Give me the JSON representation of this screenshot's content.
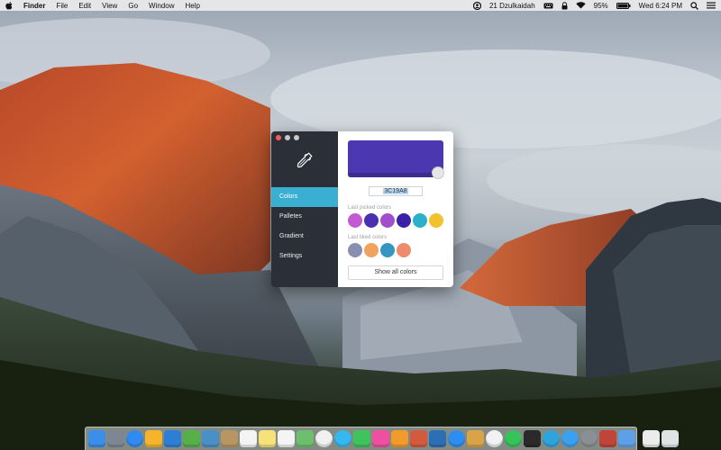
{
  "menubar": {
    "app_name": "Finder",
    "menus": [
      "File",
      "Edit",
      "View",
      "Go",
      "Window",
      "Help"
    ],
    "user": "21 Dzulkaidah",
    "battery": "95%",
    "clock": "Wed 6:24 PM"
  },
  "app": {
    "nav": [
      "Colors",
      "Palletes",
      "Gradient",
      "Settings"
    ],
    "active_nav": "Colors",
    "current_color": "#4B37B0",
    "hex_value": "3C19A8",
    "last_picked_label": "Last picked colors",
    "last_picked": [
      "#c25bd3",
      "#4a30b0",
      "#a24fcf",
      "#3a21a8",
      "#2ab0c8",
      "#f2c12e"
    ],
    "last_liked_label": "Last liked colors",
    "last_liked": [
      "#8a8fb0",
      "#f0a35e",
      "#3597c0",
      "#ef8a6e"
    ],
    "show_all_label": "Show all colors"
  },
  "dock": {
    "icons": [
      {
        "name": "finder-icon",
        "color": "#3b8fe8"
      },
      {
        "name": "launchpad-icon",
        "color": "#7d8794"
      },
      {
        "name": "safari-icon",
        "color": "#2f8bf0"
      },
      {
        "name": "sketch-icon",
        "color": "#f5b42b"
      },
      {
        "name": "photoshop-icon",
        "color": "#2d7fd6"
      },
      {
        "name": "leaf-icon",
        "color": "#55b04a"
      },
      {
        "name": "preview-icon",
        "color": "#4a90c8"
      },
      {
        "name": "notebook-icon",
        "color": "#b89561"
      },
      {
        "name": "calendar-icon",
        "color": "#f4f4f4"
      },
      {
        "name": "notes-icon",
        "color": "#f7e27a"
      },
      {
        "name": "reminders-icon",
        "color": "#f4f4f4"
      },
      {
        "name": "maps-icon",
        "color": "#6cbf6c"
      },
      {
        "name": "photos-icon",
        "color": "#f0f0f0"
      },
      {
        "name": "messages-icon",
        "color": "#35b8f0"
      },
      {
        "name": "facetime-icon",
        "color": "#3ec45a"
      },
      {
        "name": "itunes-icon",
        "color": "#f04ea0"
      },
      {
        "name": "ibooks-icon",
        "color": "#f29b2c"
      },
      {
        "name": "store-icon",
        "color": "#d35a3c"
      },
      {
        "name": "colorpicker-icon",
        "color": "#2d6fb5"
      },
      {
        "name": "appstore-icon",
        "color": "#2e8ef0"
      },
      {
        "name": "burger-icon",
        "color": "#d9a447"
      },
      {
        "name": "chrome-icon",
        "color": "#f2f2f2"
      },
      {
        "name": "whatsapp-icon",
        "color": "#35c45a"
      },
      {
        "name": "terminal-icon",
        "color": "#2a2a2a"
      },
      {
        "name": "telegram-icon",
        "color": "#2ea4dd"
      },
      {
        "name": "twitter-icon",
        "color": "#3aa0ef"
      },
      {
        "name": "settings-icon",
        "color": "#8a8f96"
      },
      {
        "name": "skype-icon",
        "color": "#c0443a"
      },
      {
        "name": "airmail-icon",
        "color": "#5ea0e8"
      },
      {
        "name": "document-icon",
        "color": "#ececec"
      },
      {
        "name": "trash-icon",
        "color": "#dfe3e6"
      }
    ]
  }
}
